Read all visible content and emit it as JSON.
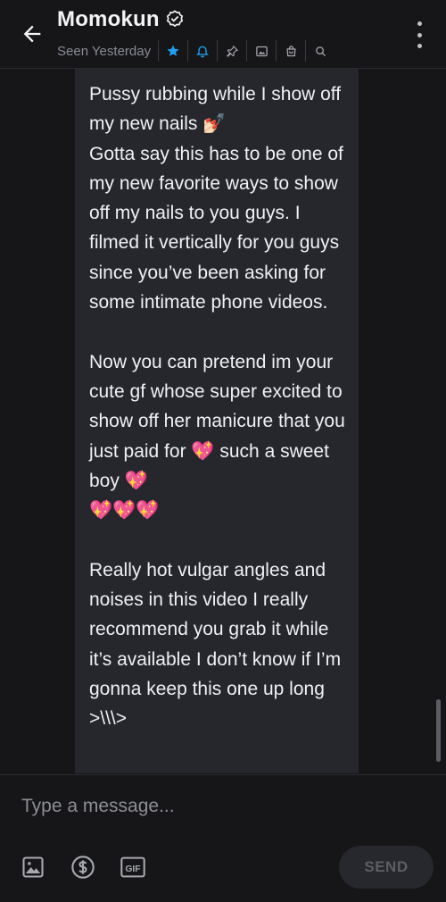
{
  "header": {
    "title": "Momokun",
    "seen_status": "Seen Yesterday",
    "icons": [
      "back-arrow-icon",
      "verified-icon",
      "star-icon",
      "bell-icon",
      "pin-icon",
      "image-icon",
      "bag-icon",
      "search-icon",
      "more-vertical-icon"
    ],
    "accent_color": "#1da1f2"
  },
  "chat": {
    "message": "Pussy rubbing while I show off my new nails 💅🏻\nGotta say this has to be one of my new favorite ways to show off my nails to you guys. I filmed it vertically for you guys since you’ve been asking for some intimate phone videos.\n\nNow you can pretend im your cute gf whose super excited to show off her manicure that you just paid for 💖 such a sweet boy 💖\n💖💖💖\n\nReally hot vulgar angles and noises in this video I really recommend you grab it while it’s available I don’t know if I’m gonna keep this one up long >\\\\\\>"
  },
  "composer": {
    "placeholder": "Type a message...",
    "value": "",
    "tools": [
      "image-icon",
      "dollar-icon",
      "gif-icon"
    ],
    "send_label": "SEND"
  }
}
